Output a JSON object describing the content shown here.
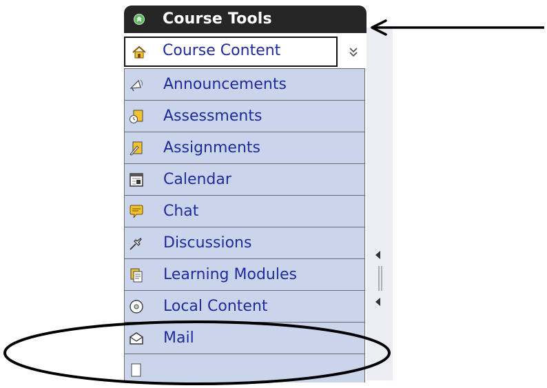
{
  "panel": {
    "title": "Course Tools",
    "items": [
      {
        "label": "Course Content",
        "icon": "home-icon"
      },
      {
        "label": "Announcements",
        "icon": "megaphone-icon"
      },
      {
        "label": "Assessments",
        "icon": "assessment-clock-icon"
      },
      {
        "label": "Assignments",
        "icon": "assignment-icon"
      },
      {
        "label": "Calendar",
        "icon": "calendar-icon"
      },
      {
        "label": "Chat",
        "icon": "chat-bubble-icon"
      },
      {
        "label": "Discussions",
        "icon": "pushpin-icon"
      },
      {
        "label": "Learning Modules",
        "icon": "documents-icon"
      },
      {
        "label": "Local Content",
        "icon": "disc-icon"
      },
      {
        "label": "Mail",
        "icon": "mail-icon"
      },
      {
        "label": "",
        "icon": "document-icon"
      }
    ]
  },
  "colors": {
    "header_bg": "#262626",
    "row_bg": "#cad5ec",
    "link_text": "#1f2a9c",
    "scroll_strip": "#ebedf2"
  },
  "annotations": {
    "arrow": "pointer to Course Tools header",
    "ellipse": "highlight around Mail item"
  }
}
